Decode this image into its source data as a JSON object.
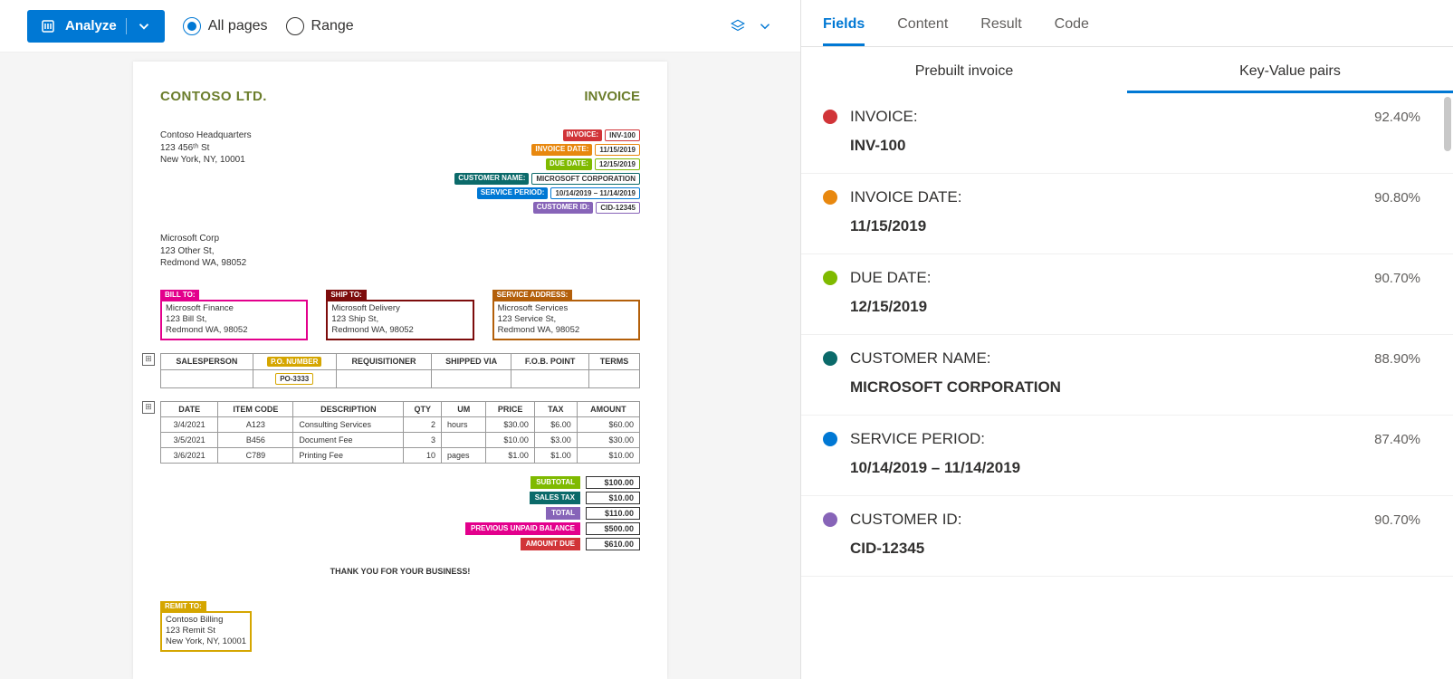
{
  "toolbar": {
    "analyze_label": "Analyze",
    "all_pages_label": "All pages",
    "range_label": "Range"
  },
  "invoice": {
    "company_name": "CONTOSO LTD.",
    "title": "INVOICE",
    "hq_name": "Contoso Headquarters",
    "hq_street": "123 456ᵗʰ St",
    "hq_city": "New York, NY, 10001",
    "customer_corp": "Microsoft Corp",
    "customer_street": "123 Other St,",
    "customer_city": "Redmond WA, 98052",
    "meta": {
      "invoice_label": "INVOICE:",
      "invoice_val": "INV-100",
      "date_label": "INVOICE DATE:",
      "date_val": "11/15/2019",
      "due_label": "DUE DATE:",
      "due_val": "12/15/2019",
      "cust_name_label": "CUSTOMER NAME:",
      "cust_name_val": "MICROSOFT CORPORATION",
      "period_label": "SERVICE PERIOD:",
      "period_val": "10/14/2019 – 11/14/2019",
      "cust_id_label": "CUSTOMER ID:",
      "cust_id_val": "CID-12345"
    },
    "bill_to_label": "BILL TO:",
    "bill_to_name": "Microsoft Finance",
    "bill_to_street": "123 Bill St,",
    "bill_to_city": "Redmond WA, 98052",
    "ship_to_label": "SHIP TO:",
    "ship_to_name": "Microsoft Delivery",
    "ship_to_street": "123 Ship St,",
    "ship_to_city": "Redmond WA, 98052",
    "service_addr_label": "SERVICE ADDRESS:",
    "service_name": "Microsoft Services",
    "service_street": "123 Service St,",
    "service_city": "Redmond WA, 98052",
    "th_salesperson": "SALESPERSON",
    "th_po": "P.O. NUMBER",
    "th_req": "REQUISITIONER",
    "th_shipped": "SHIPPED VIA",
    "th_fob": "F.O.B. POINT",
    "th_terms": "TERMS",
    "po_val": "PO-3333",
    "th_date": "DATE",
    "th_code": "ITEM CODE",
    "th_desc": "DESCRIPTION",
    "th_qty": "QTY",
    "th_um": "UM",
    "th_price": "PRICE",
    "th_tax": "TAX",
    "th_amount": "AMOUNT",
    "r1": {
      "date": "3/4/2021",
      "code": "A123",
      "desc": "Consulting Services",
      "qty": "2",
      "um": "hours",
      "price": "$30.00",
      "tax": "$6.00",
      "amount": "$60.00"
    },
    "r2": {
      "date": "3/5/2021",
      "code": "B456",
      "desc": "Document Fee",
      "qty": "3",
      "um": "",
      "price": "$10.00",
      "tax": "$3.00",
      "amount": "$30.00"
    },
    "r3": {
      "date": "3/6/2021",
      "code": "C789",
      "desc": "Printing Fee",
      "qty": "10",
      "um": "pages",
      "price": "$1.00",
      "tax": "$1.00",
      "amount": "$10.00"
    },
    "totals": {
      "subtotal_label": "SUBTOTAL",
      "subtotal_val": "$100.00",
      "salestax_label": "SALES TAX",
      "salestax_val": "$10.00",
      "total_label": "TOTAL",
      "total_val": "$110.00",
      "prev_label": "PREVIOUS UNPAID BALANCE",
      "prev_val": "$500.00",
      "due_label": "AMOUNT DUE",
      "due_val": "$610.00"
    },
    "thank_you": "THANK YOU FOR YOUR BUSINESS!",
    "remit_label": "REMIT TO:",
    "remit_name": "Contoso Billing",
    "remit_street": "123 Remit St",
    "remit_city": "New York, NY, 10001"
  },
  "right": {
    "tabs": {
      "fields": "Fields",
      "content": "Content",
      "result": "Result",
      "code": "Code"
    },
    "sub_tabs": {
      "prebuilt": "Prebuilt invoice",
      "kvp": "Key-Value pairs"
    },
    "fields": [
      {
        "name": "INVOICE:",
        "value": "INV-100",
        "conf": "92.40%",
        "color": "#d13438"
      },
      {
        "name": "INVOICE DATE:",
        "value": "11/15/2019",
        "conf": "90.80%",
        "color": "#e8880f"
      },
      {
        "name": "DUE DATE:",
        "value": "12/15/2019",
        "conf": "90.70%",
        "color": "#7fba00"
      },
      {
        "name": "CUSTOMER NAME:",
        "value": "MICROSOFT CORPORATION",
        "conf": "88.90%",
        "color": "#0b6a6a"
      },
      {
        "name": "SERVICE PERIOD:",
        "value": "10/14/2019 – 11/14/2019",
        "conf": "87.40%",
        "color": "#0078d4"
      },
      {
        "name": "CUSTOMER ID:",
        "value": "CID-12345",
        "conf": "90.70%",
        "color": "#8764b8"
      }
    ]
  }
}
